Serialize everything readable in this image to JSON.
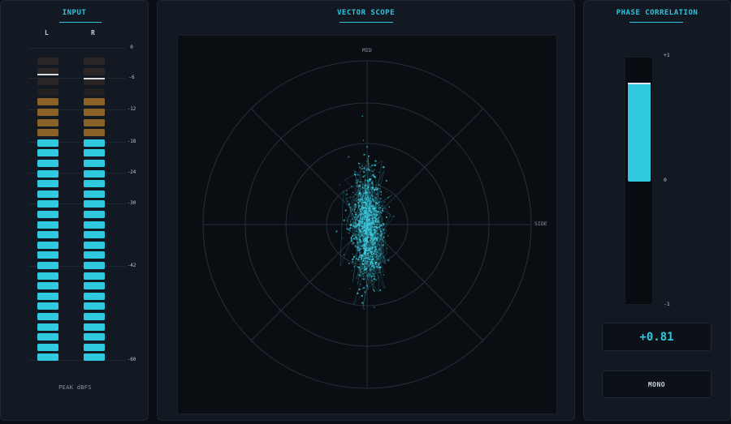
{
  "input": {
    "title": "INPUT",
    "left_label": "L",
    "right_label": "R",
    "scale": [
      "0",
      "-6",
      "-12",
      "-18",
      "-24",
      "-30",
      "-42",
      "-60"
    ],
    "footer": "PEAK dBFS",
    "left_level_segments": 30,
    "right_level_segments": 30,
    "total_segments": 30,
    "colors": {
      "cyan": "#2fc9e0",
      "amber": "#8a6228",
      "dim": "#2b2526"
    }
  },
  "scope": {
    "title": "VECTOR SCOPE",
    "mid_label": "MID",
    "side_label": "SIDE"
  },
  "phase": {
    "title": "PHASE CORRELATION",
    "top_label": "+1",
    "mid_label": "0",
    "bottom_label": "-1",
    "value": 0.81,
    "value_text": "+0.81",
    "mono_label": "MONO",
    "accent": "#2fc9e0"
  }
}
